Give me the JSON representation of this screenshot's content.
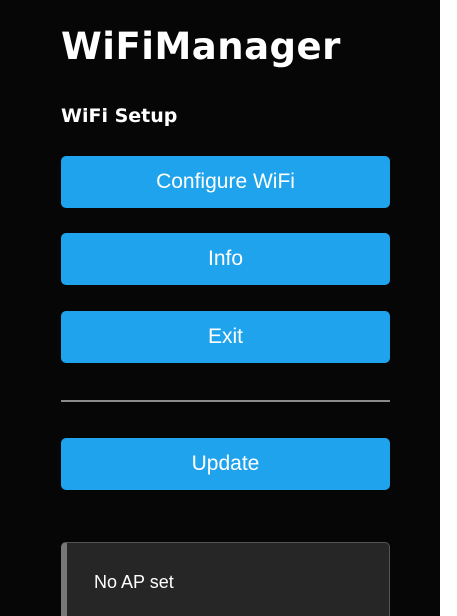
{
  "app": {
    "title": "WiFiManager",
    "section_title": "WiFi Setup"
  },
  "menu": {
    "configure_wifi_label": "Configure WiFi",
    "info_label": "Info",
    "exit_label": "Exit",
    "update_label": "Update"
  },
  "status": {
    "message": "No AP set"
  },
  "colors": {
    "background": "#060606",
    "button": "#1fa3ec",
    "button_text": "#ffffff",
    "message_box": "#262626"
  }
}
